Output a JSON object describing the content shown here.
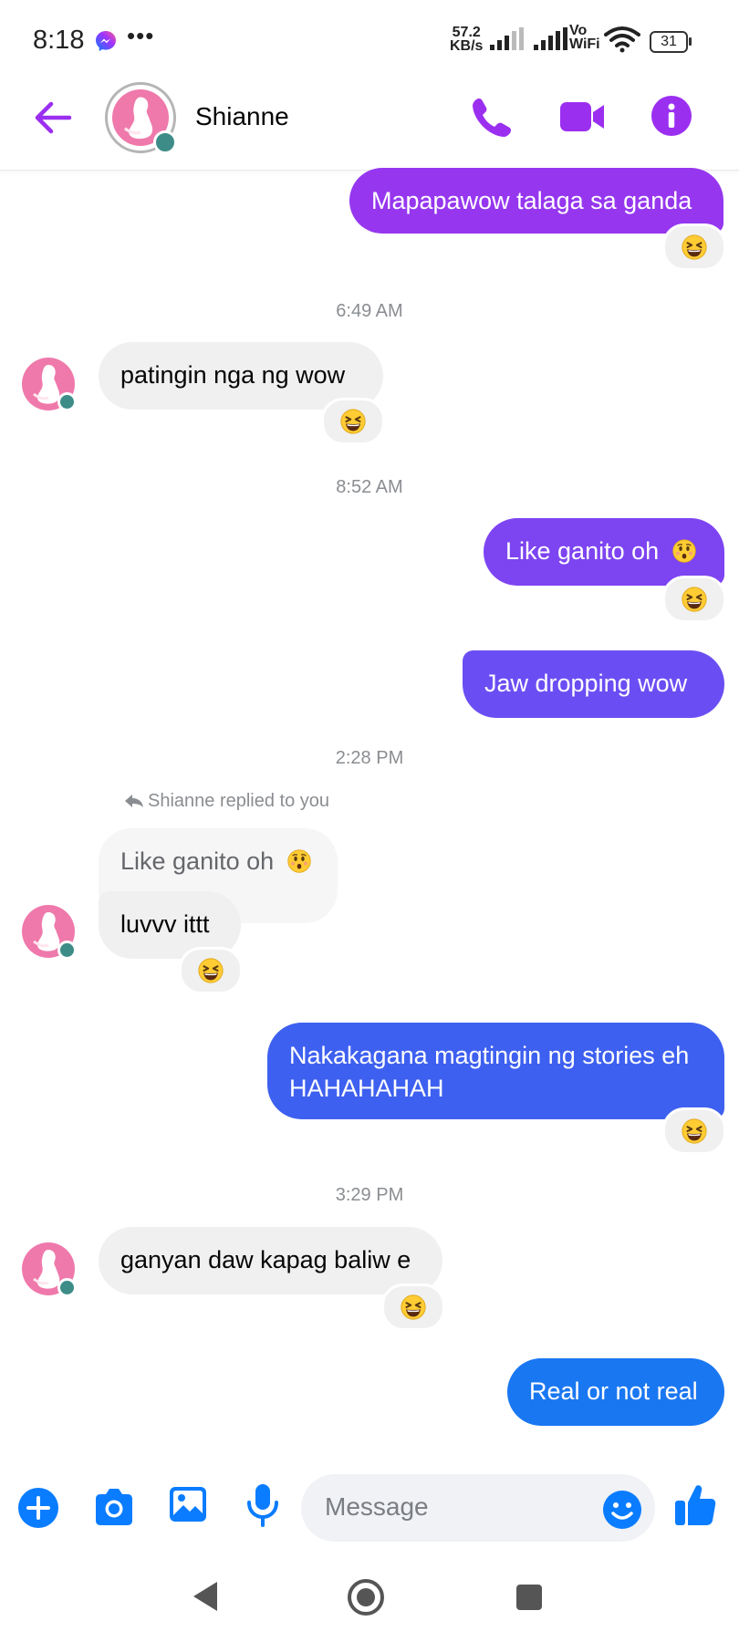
{
  "status_bar": {
    "time": "8:18",
    "net_speed_value": "57.2",
    "net_speed_unit": "KB/s",
    "vowifi_top": "Vo",
    "vowifi_bottom": "WiFi",
    "battery": "31"
  },
  "header": {
    "contact_name": "Shianne"
  },
  "messages": {
    "m1_text": "Mapapawow talaga sa ganda",
    "ts1": "6:49 AM",
    "m2_text": "patingin nga ng wow",
    "ts2": "8:52 AM",
    "m3_text": "Like ganito oh",
    "m4_text": "Jaw dropping wow",
    "ts3": "2:28 PM",
    "reply_notice": "Shianne replied to you",
    "quoted_text": "Like ganito oh",
    "m5_text": "luvvv ittt",
    "m6_line1": "Nakakagana magtingin ng stories eh",
    "m6_line2": "HAHAHAHAH",
    "ts4": "3:29 PM",
    "m7_text": "ganyan daw kapag baliw e",
    "m8_text": "Real or not real"
  },
  "composer": {
    "placeholder": "Message"
  },
  "colors": {
    "accent_purple": "#9b2ff0",
    "bubble_gradient_purple": "#9637ef",
    "bubble_gradient_indigo": "#6b4ef3",
    "bubble_gradient_blue": "#3e60f0",
    "bubble_blue": "#1a77f2",
    "icon_blue": "#0a7cff"
  },
  "icons": [
    "back-arrow-icon",
    "phone-icon",
    "video-camera-icon",
    "info-icon",
    "plus-icon",
    "camera-icon",
    "gallery-icon",
    "microphone-icon",
    "emoji-icon",
    "thumbs-up-icon",
    "laughing-emoji-icon",
    "astonished-emoji-icon"
  ]
}
